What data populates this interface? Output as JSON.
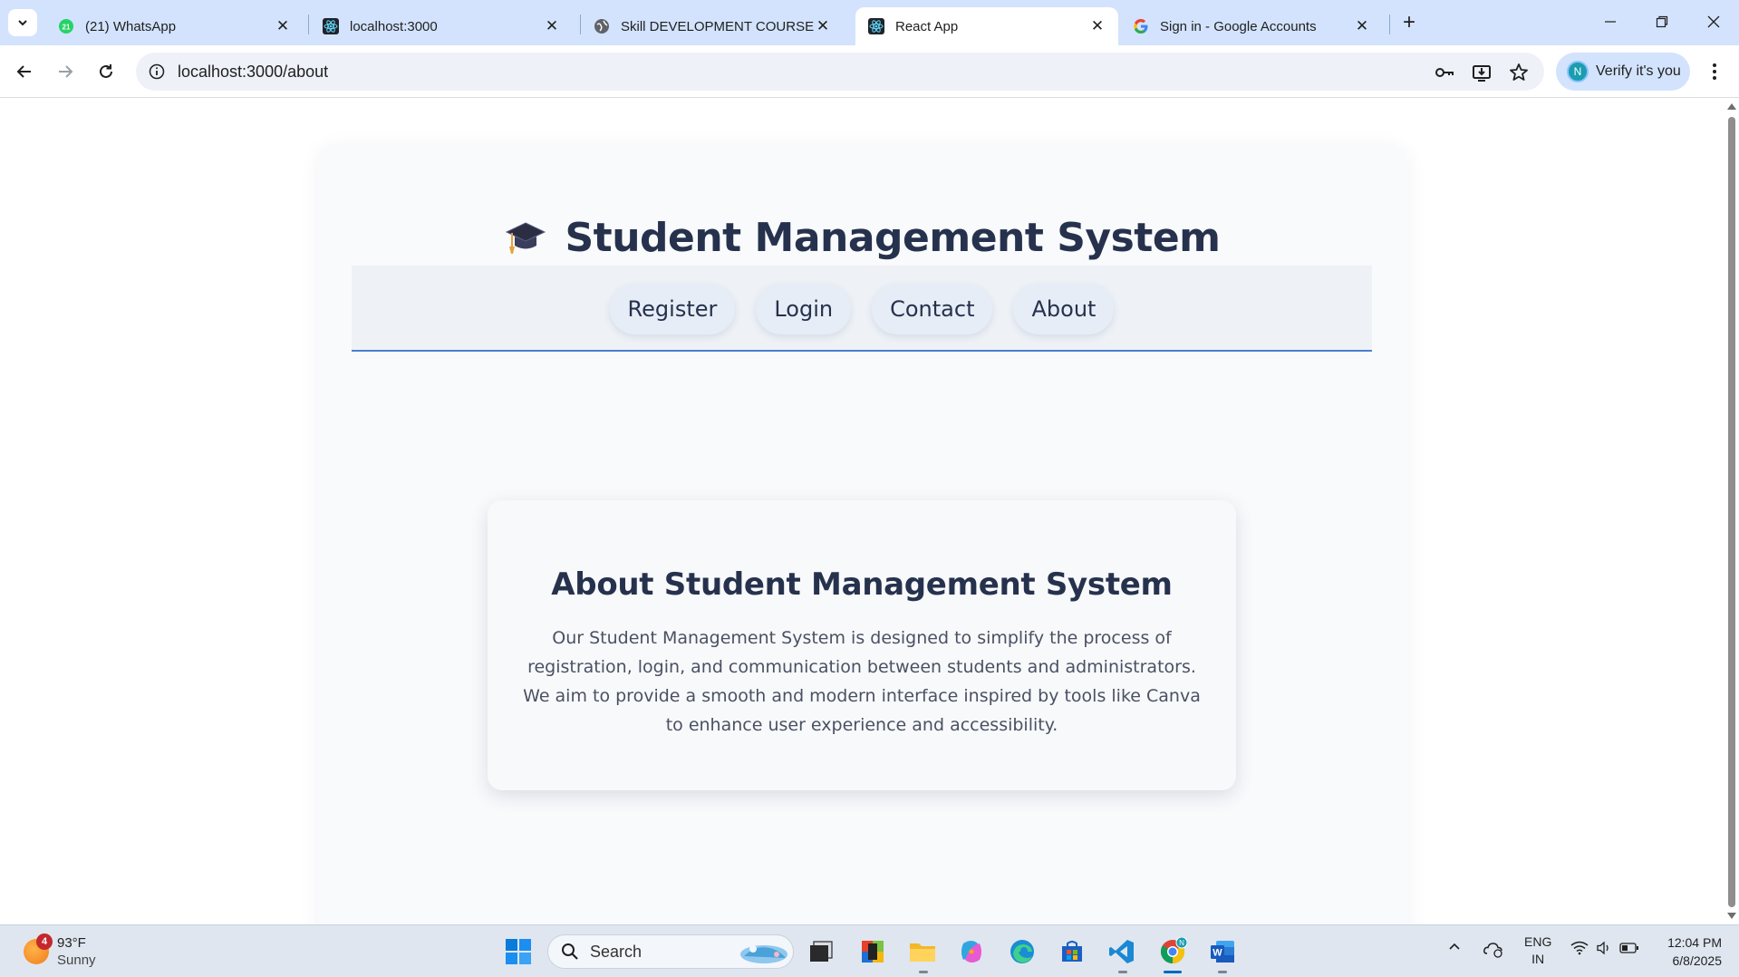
{
  "browser": {
    "tabs": [
      {
        "title": "(21) WhatsApp",
        "favicon": "whatsapp-icon",
        "badge": "21",
        "active": false
      },
      {
        "title": "localhost:3000",
        "favicon": "react-icon",
        "active": false
      },
      {
        "title": "Skill DEVELOPMENT COURSE",
        "favicon": "globe-icon",
        "active": false
      },
      {
        "title": "React App",
        "favicon": "react-icon",
        "active": true
      },
      {
        "title": "Sign in - Google Accounts",
        "favicon": "google-icon",
        "active": false
      }
    ],
    "address": "localhost:3000/about",
    "profile_button": "Verify it's you",
    "profile_initial": "N"
  },
  "page": {
    "app_title": "Student Management System",
    "app_icon": "graduation-cap-icon",
    "nav": [
      {
        "label": "Register"
      },
      {
        "label": "Login"
      },
      {
        "label": "Contact"
      },
      {
        "label": "About"
      }
    ],
    "about": {
      "heading": "About Student Management System",
      "body": "Our Student Management System is designed to simplify the process of registration, login, and communication between students and administrators. We aim to provide a smooth and modern interface inspired by tools like Canva to enhance user experience and accessibility."
    }
  },
  "taskbar": {
    "weather_temp": "93°F",
    "weather_condition": "Sunny",
    "weather_badge": "4",
    "search_label": "Search",
    "language": "ENG",
    "region": "IN",
    "time": "12:04 PM",
    "date": "6/8/2025"
  },
  "colors": {
    "tabstrip": "#d3e3fd",
    "heading": "#26324d",
    "nav_underline": "#4a7fce",
    "taskbar": "#dfe6ef"
  }
}
